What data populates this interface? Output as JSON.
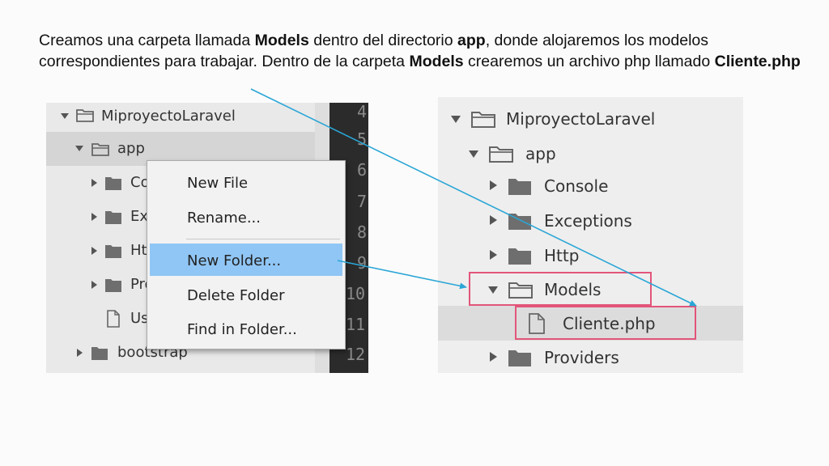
{
  "caption": {
    "p1": "Creamos una carpeta llamada ",
    "b1": "Models",
    "p2": " dentro del directorio ",
    "b2": "app",
    "p3": ", donde alojaremos los modelos correspondientes para trabajar. Dentro de la carpeta ",
    "b3": "Models",
    "p4": " crearemos un archivo php llamado ",
    "b4": "Cliente.php"
  },
  "left_tree": {
    "root": "MiproyectoLaravel",
    "app": "app",
    "items": [
      "Co",
      "Ex",
      "Htt",
      "Pro",
      "Us"
    ],
    "bootstrap": "bootstrap"
  },
  "editor": {
    "line_numbers": [
      "4",
      "5",
      "6",
      "7",
      "8",
      "9",
      "10",
      "11",
      "12"
    ]
  },
  "context_menu": {
    "new_file": "New File",
    "rename": "Rename...",
    "new_folder": "New Folder...",
    "delete_folder": "Delete Folder",
    "find_in_folder": "Find in Folder..."
  },
  "right_tree": {
    "root": "MiproyectoLaravel",
    "app": "app",
    "console": "Console",
    "exceptions": "Exceptions",
    "http": "Http",
    "models": "Models",
    "cliente": "Cliente.php",
    "providers": "Providers"
  },
  "colors": {
    "highlight_box": "#e2557a",
    "arrow": "#2aa6d6",
    "menu_highlight": "#90c6f5"
  },
  "icons": [
    "folder-icon",
    "file-icon",
    "expand-arrow-icon",
    "collapse-arrow-icon"
  ]
}
